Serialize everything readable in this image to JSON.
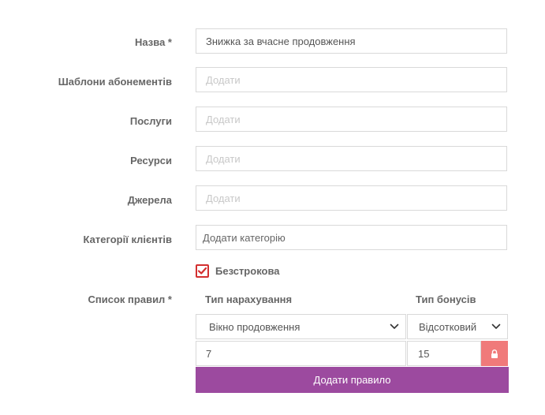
{
  "form": {
    "name": {
      "label": "Назва *",
      "value": "Знижка за вчасне продовження"
    },
    "templates": {
      "label": "Шаблони абонементів",
      "placeholder": "Додати"
    },
    "services": {
      "label": "Послуги",
      "placeholder": "Додати"
    },
    "resources": {
      "label": "Ресурси",
      "placeholder": "Додати"
    },
    "sources": {
      "label": "Джерела",
      "placeholder": "Додати"
    },
    "client_categories": {
      "label": "Категорії клієнтів",
      "placeholder": "Додати категорію"
    },
    "unlimited": {
      "label": "Безстрокова",
      "checked": true,
      "color": "#d32f2f"
    }
  },
  "rules": {
    "label": "Список правил *",
    "accrual_type_header": "Тип нарахування",
    "bonus_type_header": "Тип бонусів",
    "rows": [
      {
        "accrual_type": "Вікно продовження",
        "bonus_type": "Відсотковий",
        "accrual_value": "7",
        "bonus_value": "15"
      }
    ],
    "add_button": "Додати правило",
    "add_button_color": "#9c4a9f",
    "lock_color": "#f07a7a"
  }
}
